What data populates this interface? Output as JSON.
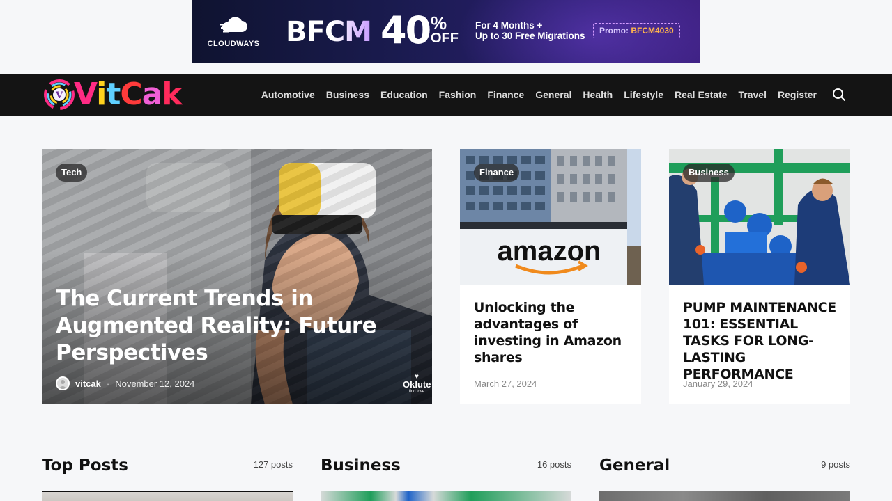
{
  "ad": {
    "brand": "CLOUDWAYS",
    "event": "BFCM",
    "discount": "40",
    "percent_sign": "%",
    "off": "OFF",
    "offer_line1": "For 4 Months +",
    "offer_line2": "Up to 30 Free Migrations",
    "promo_label": "Promo:",
    "promo_code": "BFCM4030"
  },
  "site": {
    "logo_letter": "V",
    "logo_text": [
      "V",
      "i",
      "t",
      "C",
      "a",
      "k"
    ],
    "menu": [
      "Automotive",
      "Business",
      "Education",
      "Fashion",
      "Finance",
      "General",
      "Health",
      "Lifestyle",
      "Real Estate",
      "Travel",
      "Register"
    ]
  },
  "featured": {
    "hero": {
      "category": "Tech",
      "title": "The Current Trends in Augmented Reality: Future Perspectives",
      "author": "vitcak",
      "separator": "·",
      "date": "November 12, 2024",
      "watermark": "Oklute",
      "watermark_sub": "find love"
    },
    "cards": [
      {
        "category": "Finance",
        "title": "Unlocking the advantages of investing in Amazon shares",
        "date": "March 27, 2024",
        "image_text": "amazon"
      },
      {
        "category": "Business",
        "title": "PUMP MAINTENANCE 101: ESSENTIAL TASKS FOR LONG-LASTING PERFORMANCE",
        "date": "January 29, 2024"
      }
    ]
  },
  "sections": [
    {
      "title": "Top Posts",
      "count": "127 posts"
    },
    {
      "title": "Business",
      "count": "16 posts"
    },
    {
      "title": "General",
      "count": "9 posts"
    }
  ],
  "colors": {
    "nav_bg": "#141414",
    "page_bg": "#f6f7f9",
    "promo_code": "#ffb44d"
  }
}
